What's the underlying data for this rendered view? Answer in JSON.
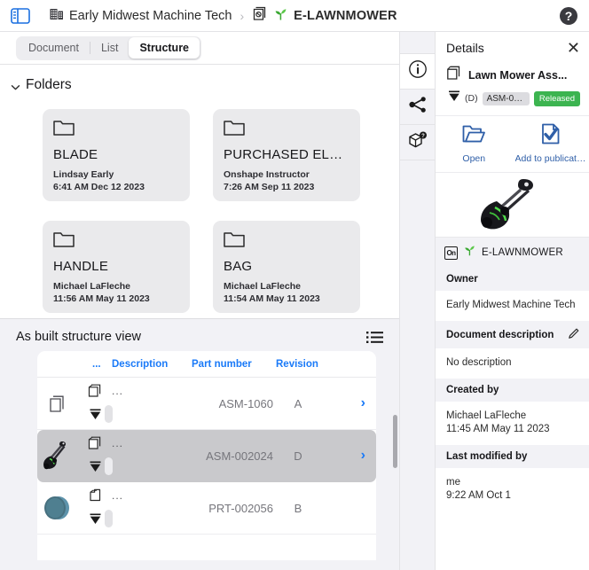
{
  "topbar": {
    "panel_toggle_icon": "sidebar-toggle-icon",
    "breadcrumb": {
      "company_icon": "building-icon",
      "company": "Early Midwest Machine Tech",
      "separator": "›",
      "doc_icon": "document-stack-icon",
      "sprout_icon": "sprout-icon",
      "current": "E-LAWNMOWER"
    },
    "help_icon": "help-circle-icon"
  },
  "tabs": [
    {
      "label": "Document",
      "selected": false
    },
    {
      "label": "List",
      "selected": false
    },
    {
      "label": "Structure",
      "selected": true
    }
  ],
  "folders_section": {
    "title": "Folders",
    "chevron_icon": "chevron-down-icon",
    "cards": [
      {
        "icon": "folder-icon",
        "name": "BLADE",
        "author": "Lindsay Early",
        "timestamp": "6:41 AM Dec 12 2023"
      },
      {
        "icon": "folder-icon",
        "name": "PURCHASED ELEC...",
        "author": "Onshape Instructor",
        "timestamp": "7:26 AM Sep 11 2023"
      },
      {
        "icon": "folder-icon",
        "name": "HANDLE",
        "author": "Michael LaFleche",
        "timestamp": "11:56 AM May 11 2023"
      },
      {
        "icon": "folder-icon",
        "name": "BAG",
        "author": "Michael LaFleche",
        "timestamp": "11:54 AM May 11 2023"
      }
    ]
  },
  "structure_view": {
    "title": "As built structure view",
    "list_icon": "list-view-icon",
    "columns": {
      "dots": "...",
      "description": "Description",
      "part_number": "Part number",
      "revision": "Revision"
    },
    "rows": [
      {
        "thumbnail_icon": "document-thumbnail-icon",
        "type_icon": "assembly-icon",
        "revision_icon": "revision-triangle-icon",
        "dots": "...",
        "description": "",
        "part_number": "ASM-1060",
        "revision": "A",
        "arrow_icon": "chevron-right-icon",
        "selected": false
      },
      {
        "thumbnail_icon": "lawnmower-thumbnail",
        "type_icon": "assembly-icon",
        "revision_icon": "revision-triangle-icon",
        "dots": "...",
        "description": "",
        "part_number": "ASM-002024",
        "revision": "D",
        "arrow_icon": "chevron-right-icon",
        "selected": true
      },
      {
        "thumbnail_icon": "disc-part-thumbnail",
        "type_icon": "part-icon",
        "revision_icon": "revision-triangle-icon",
        "dots": "...",
        "description": "",
        "part_number": "PRT-002056",
        "revision": "B",
        "arrow_icon": "",
        "selected": false
      }
    ]
  },
  "rail": {
    "items": [
      {
        "icon": "info-icon",
        "selected": true
      },
      {
        "icon": "share-icon",
        "selected": false
      },
      {
        "icon": "cube-help-icon",
        "selected": false
      }
    ]
  },
  "details": {
    "title": "Details",
    "close_icon": "close-icon",
    "item": {
      "icon": "assembly-icon",
      "name": "Lawn Mower Ass...",
      "revision_icon": "revision-triangle-icon",
      "revision_label": "(D)",
      "part_number": "ASM-002...",
      "status": "Released",
      "status_color": "#3cb450"
    },
    "actions": [
      {
        "icon": "open-folder-icon",
        "label": "Open"
      },
      {
        "icon": "add-to-publication-icon",
        "label": "Add to publicati..."
      }
    ],
    "preview_icon": "lawnmower-preview",
    "document": {
      "app_badge": "onshape-badge",
      "sprout_icon": "sprout-icon",
      "name": "E-LAWNMOWER"
    },
    "sections": [
      {
        "heading": "Owner",
        "edit_icon": "",
        "body": "Early Midwest Machine Tech"
      },
      {
        "heading": "Document description",
        "edit_icon": "pencil-icon",
        "body": "No description"
      },
      {
        "heading": "Created by",
        "edit_icon": "",
        "body": "Michael LaFleche\n11:45 AM May 11 2023"
      },
      {
        "heading": "Last modified by",
        "edit_icon": "",
        "body": "me\n9:22 AM Oct 1"
      }
    ]
  }
}
